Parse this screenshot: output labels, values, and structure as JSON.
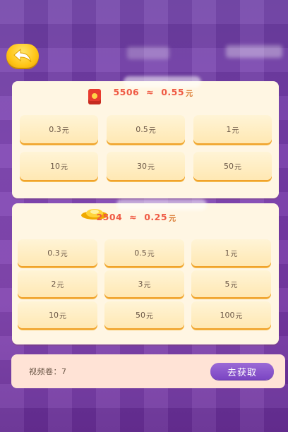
{
  "header": {
    "back_icon": "back-arrow-icon"
  },
  "panel_red_packet": {
    "icon": "red-packet-icon",
    "rate_left": "5506",
    "rate_sep": "≈",
    "rate_right": "0.55",
    "unit": "元",
    "options": [
      {
        "value": "0.3",
        "unit": "元"
      },
      {
        "value": "0.5",
        "unit": "元"
      },
      {
        "value": "1",
        "unit": "元"
      },
      {
        "value": "10",
        "unit": "元"
      },
      {
        "value": "30",
        "unit": "元"
      },
      {
        "value": "50",
        "unit": "元"
      }
    ]
  },
  "panel_gold": {
    "icon": "gold-ingot-icon",
    "rate_left": "2504",
    "rate_sep": "≈",
    "rate_right": "0.25",
    "unit": "元",
    "options": [
      {
        "value": "0.3",
        "unit": "元"
      },
      {
        "value": "0.5",
        "unit": "元"
      },
      {
        "value": "1",
        "unit": "元"
      },
      {
        "value": "2",
        "unit": "元"
      },
      {
        "value": "3",
        "unit": "元"
      },
      {
        "value": "5",
        "unit": "元"
      },
      {
        "value": "10",
        "unit": "元"
      },
      {
        "value": "50",
        "unit": "元"
      },
      {
        "value": "100",
        "unit": "元"
      }
    ]
  },
  "footer": {
    "count_label": "视频卷：7",
    "get_button": "去获取"
  },
  "colors": {
    "background": "#7a3db0",
    "panel": "#fff6e3",
    "rate_text": "#ef5a44",
    "button_purple": "#8a55cc",
    "back_button_yellow": "#ffc516"
  }
}
